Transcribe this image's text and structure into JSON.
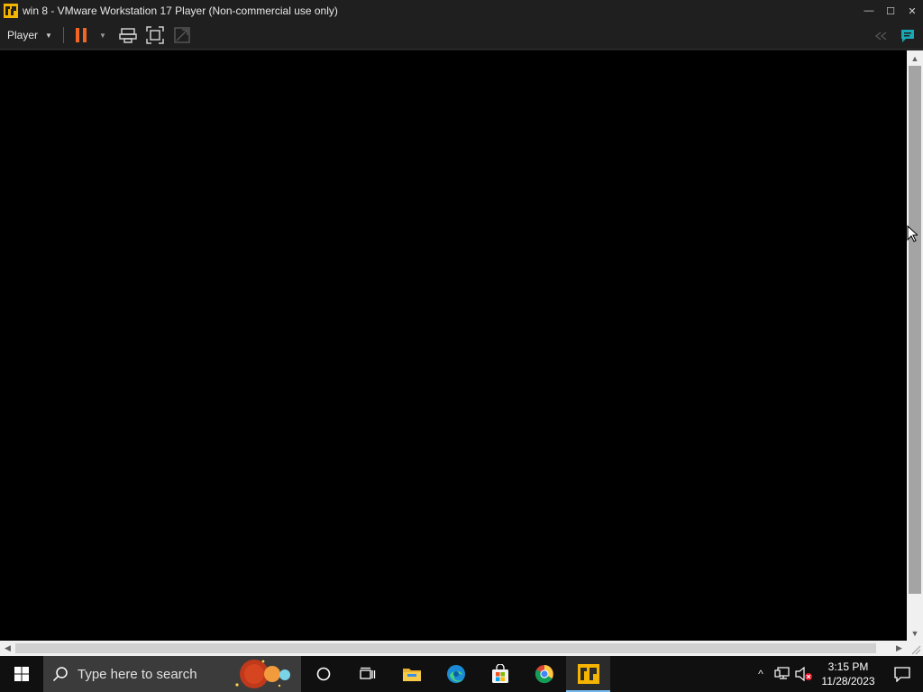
{
  "window": {
    "title": "win 8 - VMware Workstation 17 Player (Non-commercial use only)",
    "controls": {
      "minimize": "—",
      "maximize": "☐",
      "close": "✕"
    }
  },
  "toolbar": {
    "player_label": "Player",
    "player_caret": "▼",
    "pause_caret": "▼",
    "icons": [
      "pause-icon",
      "send-ctrl-alt-del-icon",
      "full-screen-icon",
      "unity-icon",
      "back-arrows-icon",
      "message-log-icon"
    ],
    "pause_color": "#f26522",
    "message_color": "#19a8b5"
  },
  "scrollbars": {
    "up": "▲",
    "down": "▼",
    "left": "◀",
    "right": "▶"
  },
  "taskbar": {
    "search_placeholder": "Type here to search",
    "apps": [
      "cortana-icon",
      "task-view-icon",
      "file-explorer-icon",
      "edge-icon",
      "microsoft-store-icon",
      "chrome-icon",
      "vmware-player-icon"
    ],
    "active_app": "vmware-player-icon",
    "tray": {
      "chevron": "^",
      "time": "3:15 PM",
      "date": "11/28/2023"
    }
  }
}
